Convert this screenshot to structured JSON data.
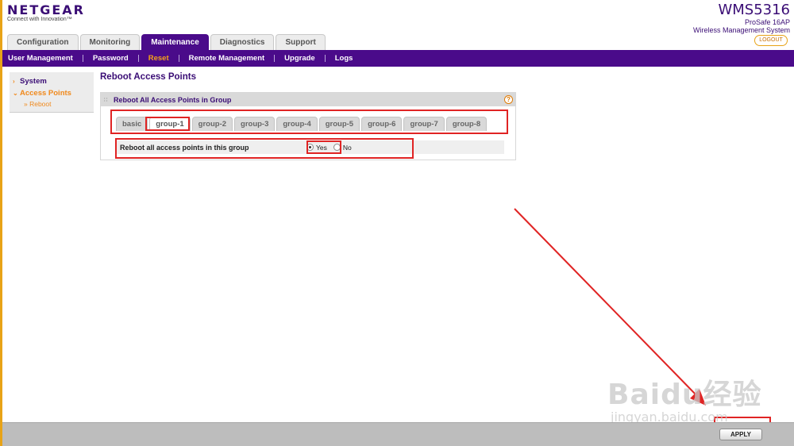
{
  "brand": {
    "logo": "NETGEAR",
    "tagline": "Connect with Innovation™",
    "product_model": "WMS5316",
    "product_line1": "ProSafe 16AP",
    "product_line2": "Wireless Management System",
    "logout_label": "LOGOUT"
  },
  "main_tabs": [
    {
      "label": "Configuration",
      "active": false
    },
    {
      "label": "Monitoring",
      "active": false
    },
    {
      "label": "Maintenance",
      "active": true
    },
    {
      "label": "Diagnostics",
      "active": false
    },
    {
      "label": "Support",
      "active": false
    }
  ],
  "sub_nav": [
    {
      "label": "User Management",
      "active": false
    },
    {
      "label": "Password",
      "active": false
    },
    {
      "label": "Reset",
      "active": true
    },
    {
      "label": "Remote Management",
      "active": false
    },
    {
      "label": "Upgrade",
      "active": false
    },
    {
      "label": "Logs",
      "active": false
    }
  ],
  "sidebar": {
    "items": [
      {
        "label": "System"
      },
      {
        "label": "Access Points"
      }
    ],
    "sub_item": "» Reboot"
  },
  "content": {
    "page_title": "Reboot Access Points",
    "panel_title": "Reboot All Access Points in Group",
    "help_symbol": "?",
    "group_tabs": [
      {
        "label": "basic",
        "active": false
      },
      {
        "label": "group-1",
        "active": true
      },
      {
        "label": "group-2",
        "active": false
      },
      {
        "label": "group-3",
        "active": false
      },
      {
        "label": "group-4",
        "active": false
      },
      {
        "label": "group-5",
        "active": false
      },
      {
        "label": "group-6",
        "active": false
      },
      {
        "label": "group-7",
        "active": false
      },
      {
        "label": "group-8",
        "active": false
      }
    ],
    "reboot_label": "Reboot all access points in this group",
    "option_yes": "Yes",
    "option_no": "No",
    "selected": "Yes"
  },
  "footer": {
    "apply_label": "APPLY"
  },
  "watermark": {
    "main": "Baidu经验",
    "sub": "jingyan.baidu.com"
  },
  "colors": {
    "brand_purple": "#4a0b8a",
    "accent_orange": "#f4a21a",
    "highlight_red": "#e02424"
  }
}
